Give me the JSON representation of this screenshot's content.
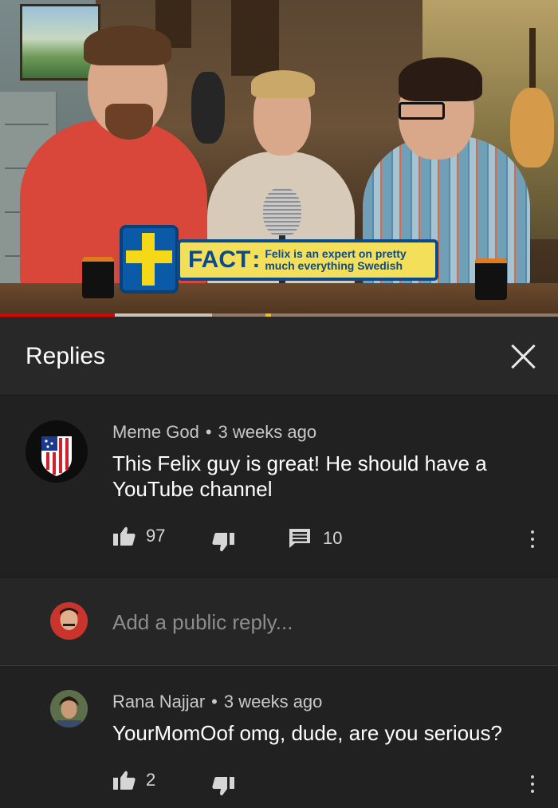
{
  "video": {
    "banner": {
      "title": "FACT",
      "text_line1": "Felix is an expert on pretty",
      "text_line2": "much everything Swedish"
    },
    "progress": {
      "played_fraction": 0.205,
      "buffered_fraction": 0.38
    },
    "colors": {
      "progress": "#e00000",
      "banner_bg": "#f3df5a",
      "banner_accent": "#0a4a8e",
      "flag_blue": "#0b5aa8",
      "flag_yellow": "#f5d817"
    }
  },
  "header": {
    "title": "Replies",
    "close_icon": "close-icon"
  },
  "comments": [
    {
      "author": "Meme God",
      "age": "3 weeks ago",
      "text_line1": "This Felix guy is great! He should have a",
      "text_line2": "YouTube channel",
      "likes": "97",
      "replies": "10"
    },
    {
      "author": "Rana Najjar",
      "age": "3 weeks ago",
      "text": "YourMomOof omg, dude, are you serious?",
      "likes": "2"
    }
  ],
  "reply_input": {
    "placeholder": "Add a public reply..."
  },
  "icons": {
    "like": "thumbs-up-icon",
    "dislike": "thumbs-down-icon",
    "reply": "comment-icon",
    "more": "more-vertical-icon"
  },
  "separator": "•"
}
